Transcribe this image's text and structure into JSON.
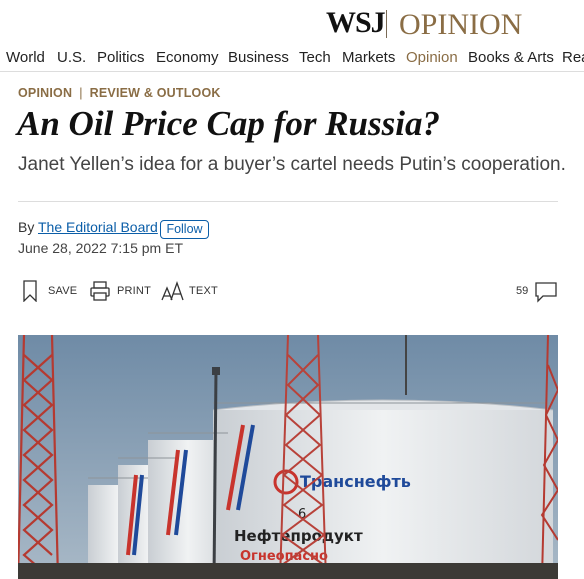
{
  "masthead": {
    "logo": "WSJ",
    "section": "OPINION"
  },
  "nav": {
    "items": [
      "World",
      "U.S.",
      "Politics",
      "Economy",
      "Business",
      "Tech",
      "Markets",
      "Opinion",
      "Books & Arts",
      "Real Estate"
    ],
    "active": "Opinion"
  },
  "article": {
    "kicker": {
      "section": "OPINION",
      "subsection": "REVIEW & OUTLOOK"
    },
    "headline": "An Oil Price Cap for Russia?",
    "dek": "Janet Yellen’s idea for a buyer’s cartel needs Putin’s cooperation.",
    "byline": {
      "prefix": "By",
      "author": "The Editorial Board",
      "follow_label": "Follow"
    },
    "date": "June 28, 2022 7:15 pm ET"
  },
  "toolbar": {
    "save_label": "SAVE",
    "print_label": "PRINT",
    "text_label": "TEXT",
    "comment_count": "59"
  },
  "photo": {
    "tank_text": {
      "brand": "Транснефть",
      "product": "Нефтепродукт",
      "warning": "Огнеопасно",
      "number": "6"
    }
  },
  "colors": {
    "accent": "#8a6d45",
    "link": "#0b5ea8",
    "sky": "#7f9bb4",
    "tank": "#e8eaec",
    "tower": "#c23a32"
  }
}
